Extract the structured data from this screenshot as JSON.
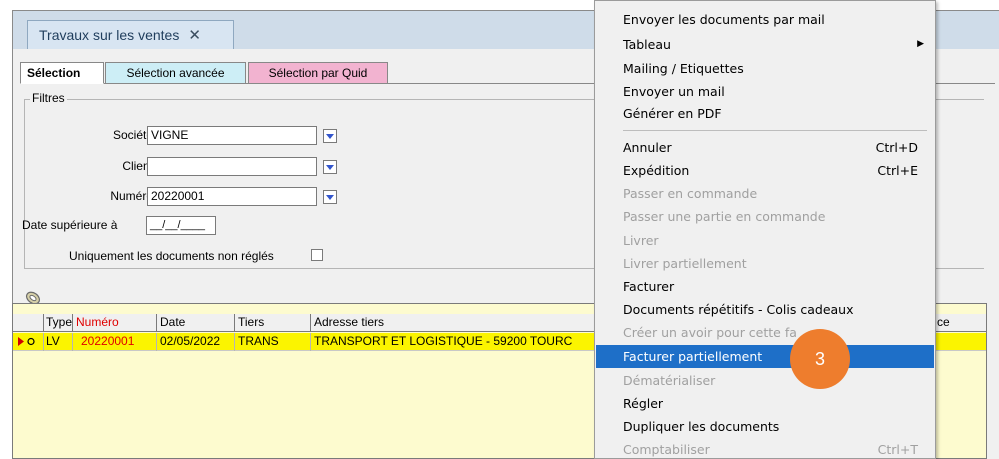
{
  "window": {
    "tab_title": "Travaux sur les ventes",
    "close_glyph": "✕"
  },
  "subtabs": [
    {
      "label": "Sélection",
      "color": "#ffffff"
    },
    {
      "label": "Sélection avancée",
      "color": "#cdeef6"
    },
    {
      "label": "Sélection par Quid",
      "color": "#f2b3d0"
    }
  ],
  "filters": {
    "legend": "Filtres",
    "societes": {
      "label": "Sociétés",
      "value": "VIGNE"
    },
    "clients": {
      "label": "Clients",
      "value": ""
    },
    "numeros": {
      "label": "Numéros",
      "value": "20220001"
    },
    "date_sup": {
      "label": "Date supérieure à",
      "value": "__/__/____"
    },
    "non_regles": {
      "label": "Uniquement les documents non réglés",
      "checked": false
    }
  },
  "grid": {
    "columns": [
      "Type",
      "Numéro",
      "Date",
      "Tiers",
      "Adresse tiers",
      "ce"
    ],
    "rows": [
      {
        "type": "LV",
        "numero": "20220001",
        "date": "02/05/2022",
        "tiers": "TRANS",
        "adresse": "TRANSPORT ET LOGISTIQUE - 59200  TOURC"
      }
    ],
    "highlight_color": "#fbf400",
    "numero_color": "#e00000"
  },
  "context_menu": {
    "items": [
      {
        "label": "Envoyer les documents par mail",
        "enabled": true,
        "shortcut": ""
      },
      {
        "label": "Tableau",
        "enabled": true,
        "shortcut": "",
        "submenu": true
      },
      {
        "label": "Mailing / Etiquettes",
        "enabled": true,
        "shortcut": ""
      },
      {
        "label": "Envoyer un mail",
        "enabled": true,
        "shortcut": ""
      },
      {
        "label": "Générer en PDF",
        "enabled": true,
        "shortcut": ""
      },
      {
        "label": "Annuler",
        "enabled": true,
        "shortcut": "Ctrl+D"
      },
      {
        "label": "Expédition",
        "enabled": true,
        "shortcut": "Ctrl+E"
      },
      {
        "label": "Passer en commande",
        "enabled": false,
        "shortcut": ""
      },
      {
        "label": "Passer une partie en commande",
        "enabled": false,
        "shortcut": ""
      },
      {
        "label": "Livrer",
        "enabled": false,
        "shortcut": ""
      },
      {
        "label": "Livrer partiellement",
        "enabled": false,
        "shortcut": ""
      },
      {
        "label": "Facturer",
        "enabled": true,
        "shortcut": ""
      },
      {
        "label": "Documents répétitifs - Colis cadeaux",
        "enabled": true,
        "shortcut": ""
      },
      {
        "label": "Créer un avoir pour cette fa",
        "enabled": false,
        "shortcut": ""
      },
      {
        "label": "Facturer partiellement",
        "enabled": true,
        "shortcut": "",
        "highlighted": true
      },
      {
        "label": "Dématérialiser",
        "enabled": false,
        "shortcut": ""
      },
      {
        "label": "Régler",
        "enabled": true,
        "shortcut": ""
      },
      {
        "label": "Dupliquer les documents",
        "enabled": true,
        "shortcut": ""
      },
      {
        "label": "Comptabiliser",
        "enabled": false,
        "shortcut": "Ctrl+T"
      }
    ],
    "highlight_color": "#1e6fc8"
  },
  "step_badge": {
    "label": "3",
    "color": "#ee7d2d"
  },
  "icons": [
    "close-icon",
    "dropdown-arrow-icon",
    "checkbox",
    "paperclip-icon",
    "row-pointer-icon",
    "submenu-arrow-icon"
  ]
}
